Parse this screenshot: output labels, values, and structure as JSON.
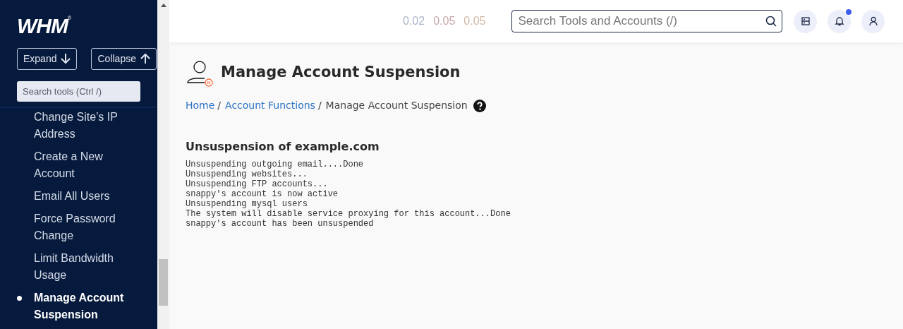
{
  "sidebar": {
    "logo": "WHM",
    "logo_mark": "®",
    "expand_button": "Expand",
    "collapse_button": "Collapse",
    "search": {
      "placeholder": "Search tools (Ctrl /)"
    },
    "items": [
      {
        "label": "Change Site’s IP Address",
        "selected": false
      },
      {
        "label": "Create a New Account",
        "selected": false
      },
      {
        "label": "Email All Users",
        "selected": false
      },
      {
        "label": "Force Password Change",
        "selected": false
      },
      {
        "label": "Limit Bandwidth Usage",
        "selected": false
      },
      {
        "label": "Manage Account Suspension",
        "selected": true
      }
    ]
  },
  "header": {
    "load_averages": [
      {
        "value": "0.02",
        "color": "#a9b4c8"
      },
      {
        "value": "0.05",
        "color": "#c8aaa8"
      },
      {
        "value": "0.05",
        "color": "#d2b8a4"
      }
    ],
    "search": {
      "placeholder": "Search Tools and Accounts (/)"
    },
    "notifications": {
      "unread": true
    }
  },
  "page": {
    "title": "Manage Account Suspension",
    "breadcrumb": [
      {
        "label": "Home",
        "link": true,
        "separator": "/"
      },
      {
        "label": "Account Functions",
        "link": true,
        "separator": "/"
      },
      {
        "label": "Manage Account Suspension",
        "link": false
      }
    ],
    "section_title": "Unsuspension of example.com",
    "output": [
      "Unsuspending outgoing email....Done",
      "Unsuspending websites...",
      "Unsuspending FTP accounts...",
      "snappy's account is now active",
      "Unsuspending mysql users",
      "The system will disable service proxying for this account...Done",
      "snappy's account has been unsuspended"
    ]
  }
}
